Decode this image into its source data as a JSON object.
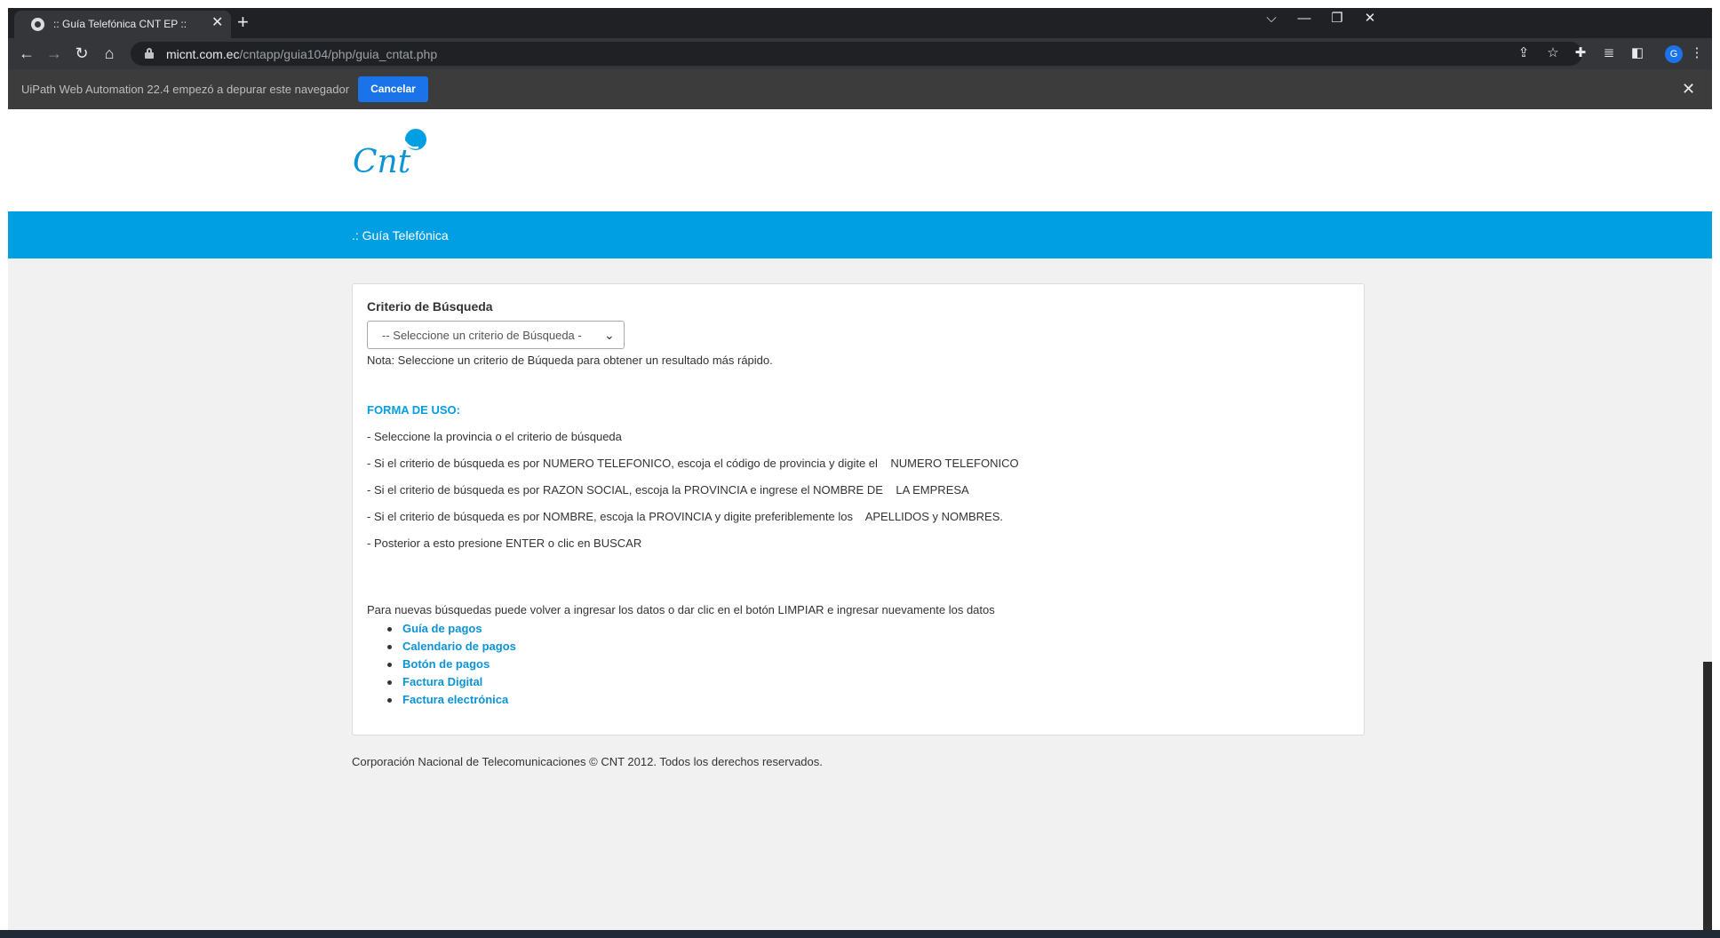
{
  "browser": {
    "tab_title": ":: Guía Telefónica CNT EP ::",
    "tab_close": "✕",
    "new_tab": "+",
    "url_host": "micnt.com.ec",
    "url_path": "/cntapp/guia104/php/guia_cntat.php",
    "avatar_letter": "G",
    "window_controls": {
      "dropdown": "⌵",
      "minimize": "—",
      "restore": "❐",
      "close": "✕"
    },
    "nav": {
      "back": "←",
      "forward": "→",
      "reload": "↻",
      "home": "⌂"
    }
  },
  "infobar": {
    "message": "UiPath Web Automation 22.4 empezó a depurar este navegador",
    "cancel_label": "Cancelar",
    "close": "✕"
  },
  "page": {
    "logo_text": "Cnt",
    "breadcrumb": ".: Guía Telefónica",
    "search": {
      "label": "Criterio de Búsqueda",
      "select_value": "-- Seleccione un criterio de Búsqueda -",
      "note": "Nota: Seleccione un criterio de Búqueda para obtener un resultado más rápido."
    },
    "usage": {
      "title": "FORMA DE USO:",
      "lines": [
        "- Seleccione la provincia o el criterio de búsqueda",
        "- Si el criterio de búsqueda es por NUMERO TELEFONICO, escoja el código de provincia y digite el    NUMERO TELEFONICO",
        "- Si el criterio de búsqueda es por RAZON SOCIAL, escoja la PROVINCIA e ingrese el NOMBRE DE    LA EMPRESA",
        "- Si el criterio de búsqueda es por NOMBRE, escoja la PROVINCIA y digite preferiblemente los    APELLIDOS y NOMBRES.",
        "- Posterior a esto presione ENTER o clic en BUSCAR"
      ]
    },
    "new_search_text": "Para nuevas búsquedas puede volver a ingresar los datos o dar clic en el botón LIMPIAR e ingresar nuevamente los datos",
    "links": [
      "Guía de pagos",
      "Calendario de pagos",
      "Botón de pagos",
      "Factura Digital",
      "Factura electrónica"
    ],
    "footer": "Corporación Nacional de Telecomunicaciones © CNT 2012. Todos los derechos reservados."
  },
  "colors": {
    "brand_blue": "#009ee3",
    "link_blue": "#0b93d6",
    "page_bg": "#f1f1f1",
    "chrome_dark": "#202124"
  }
}
